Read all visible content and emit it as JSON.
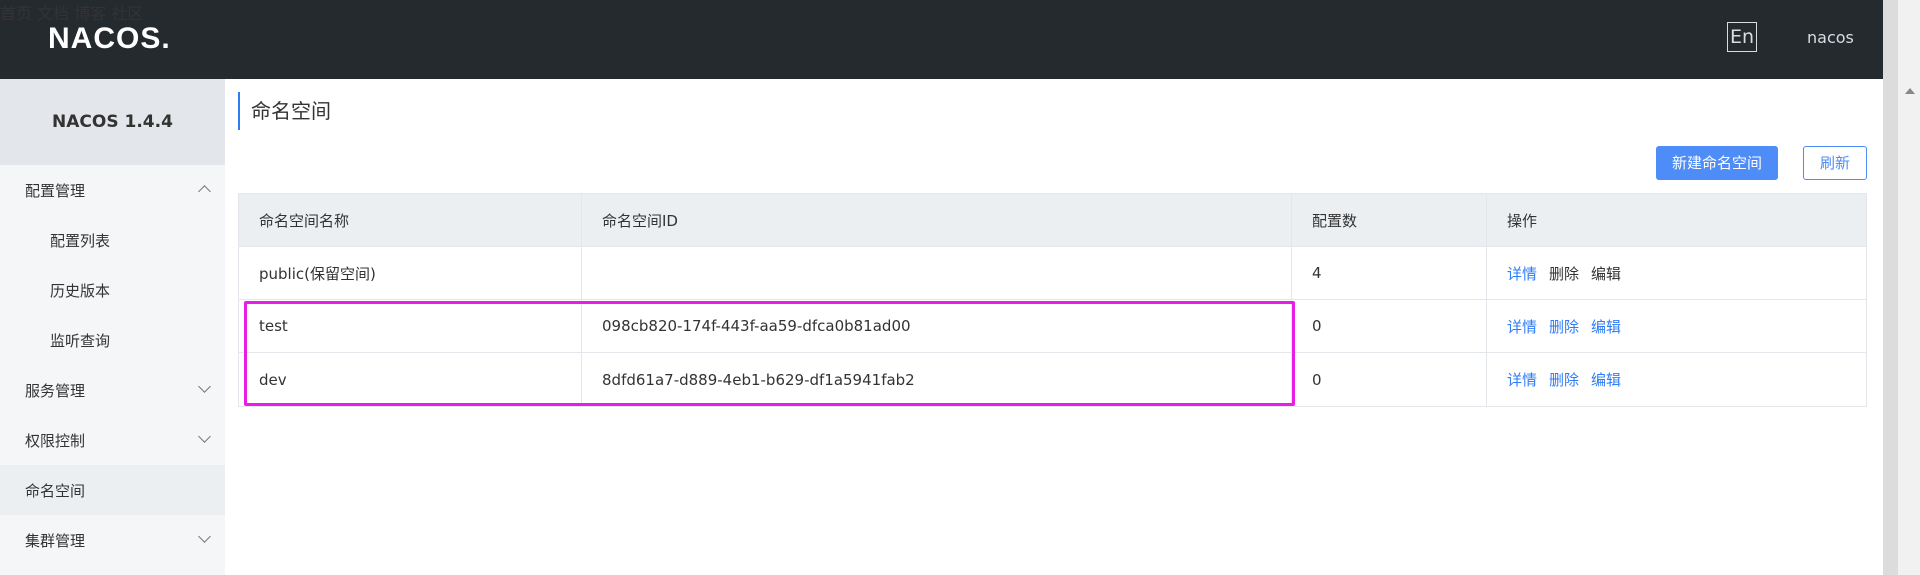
{
  "header": {
    "logo": "NACOS.",
    "nav": [
      "首页",
      "文档",
      "博客",
      "社区"
    ],
    "lang": "En",
    "user": "nacos"
  },
  "sidebar": {
    "title": "NACOS 1.4.4",
    "items": [
      {
        "label": "配置管理"
      },
      {
        "label": "配置列表"
      },
      {
        "label": "历史版本"
      },
      {
        "label": "监听查询"
      },
      {
        "label": "服务管理"
      },
      {
        "label": "权限控制"
      },
      {
        "label": "命名空间"
      },
      {
        "label": "集群管理"
      }
    ]
  },
  "main": {
    "title": "命名空间",
    "new_button": "新建命名空间",
    "refresh_button": "刷新",
    "table": {
      "headers": [
        "命名空间名称",
        "命名空间ID",
        "配置数",
        "操作"
      ],
      "rows": [
        {
          "name": "public(保留空间)",
          "id": "",
          "count": "4",
          "ops": [
            "详情",
            "删除",
            "编辑"
          ]
        },
        {
          "name": "test",
          "id": "098cb820-174f-443f-aa59-dfca0b81ad00",
          "count": "0",
          "ops": [
            "详情",
            "删除",
            "编辑"
          ]
        },
        {
          "name": "dev",
          "id": "8dfd61a7-d889-4eb1-b629-df1a5941fab2",
          "count": "0",
          "ops": [
            "详情",
            "删除",
            "编辑"
          ]
        }
      ]
    }
  },
  "colors": {
    "header_bg": "#252a2f",
    "accent": "#4e8cf7",
    "highlight": "#e61ee6"
  }
}
